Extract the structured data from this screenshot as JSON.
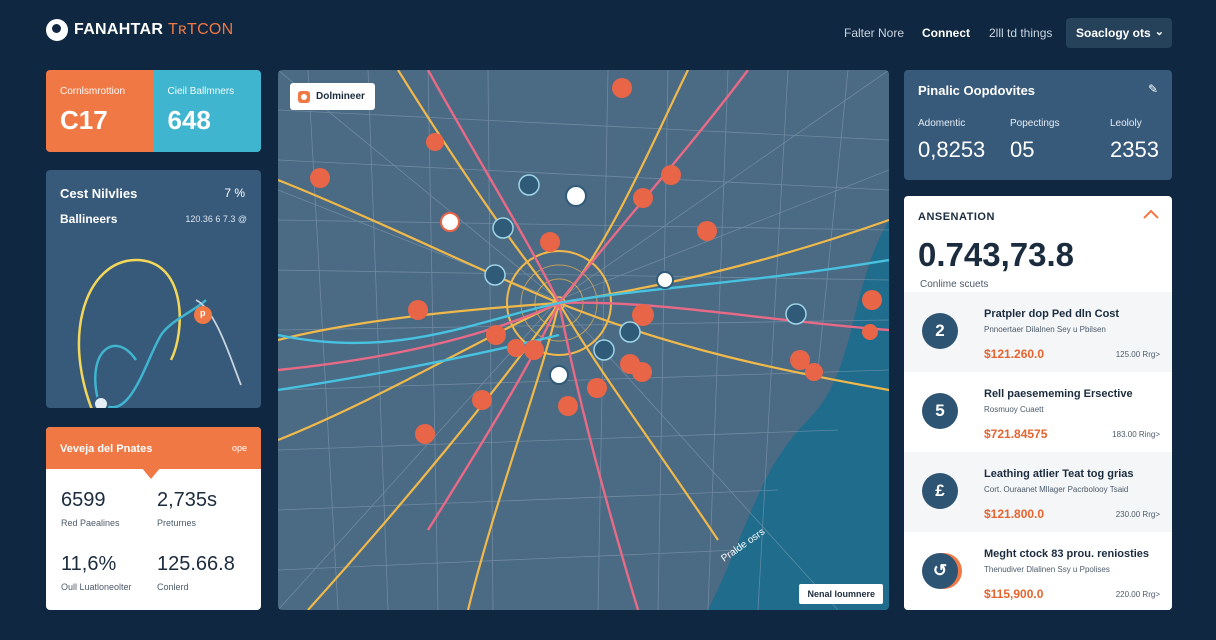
{
  "header": {
    "logo_main": "FANAHTAR",
    "logo_accent": "TʀTCON",
    "nav": [
      "Falter Nore",
      "Connect",
      "2lll td things"
    ],
    "active_nav": "Connect",
    "dropdown_label": "Soaclogy ots"
  },
  "split_card": {
    "left_label": "Cornlsmrottion",
    "left_value": "C17",
    "right_label": "Cieil Ballmners",
    "right_value": "648"
  },
  "curve_card": {
    "title": "Cest Nilvlies",
    "title_value": "7 %",
    "subtitle": "Ballineers",
    "subtitle_value": "120.36 6 7.3 @",
    "marker_label": "p"
  },
  "stats_card": {
    "title": "Veveja del Pnates",
    "action": "ope",
    "stats": [
      {
        "value": "6599",
        "label": "Red Paealines"
      },
      {
        "value": "2,735s",
        "label": "Preturnes"
      },
      {
        "value": "11,6%",
        "label": "Oull Luatloneolter"
      },
      {
        "value": "125.66.8",
        "label": "Conlerd"
      }
    ]
  },
  "map": {
    "chip_label": "Dolmineer",
    "legend_label": "Nenal loumnere",
    "water_label": "Pralde osrs"
  },
  "kpi_card": {
    "title": "Pinalic Oopdovites",
    "kpis": [
      {
        "label": "Adomentic",
        "value": "0,8253"
      },
      {
        "label": "Popectings",
        "value": "05"
      },
      {
        "label": "Leololy",
        "value": "2353"
      }
    ]
  },
  "list_card": {
    "title": "ANSENATION",
    "big_value": "0.743,73.8",
    "sub_label": "Conlime scuets",
    "rows": [
      {
        "avatar": "2",
        "name": "Pratpler dop Ped dln Cost",
        "desc": "Pnnoertaer Dilalnen Sey u Pbilsen",
        "price": "$121.260.0",
        "right": "125.00 Rrg>"
      },
      {
        "avatar": "5",
        "name": "Rell paesememing Ersective",
        "desc": "Rosmuoy Cuaett",
        "price": "$721.84575",
        "right": "183.00 Ring>"
      },
      {
        "avatar": "£",
        "name": "Leathing atlier Teat tog grias",
        "desc": "Cort. Ouraanet Mllager Pacrbolooy Tsaid",
        "price": "$121.800.0",
        "right": "230.00 Rrg>"
      },
      {
        "avatar": "↺",
        "name": "Meght ctock 83 prou. reniosties",
        "desc": "Thenudiver Dlalinen Ssy u Ppolises",
        "price": "$115,900.0",
        "right": "220.00 Rrg>"
      }
    ]
  },
  "colors": {
    "background": "#0f2740",
    "panel": "#37597a",
    "accent_orange": "#f07845",
    "accent_cyan": "#3fb5cf",
    "map_land": "#4b6a84",
    "map_water": "#1f6c8c"
  }
}
